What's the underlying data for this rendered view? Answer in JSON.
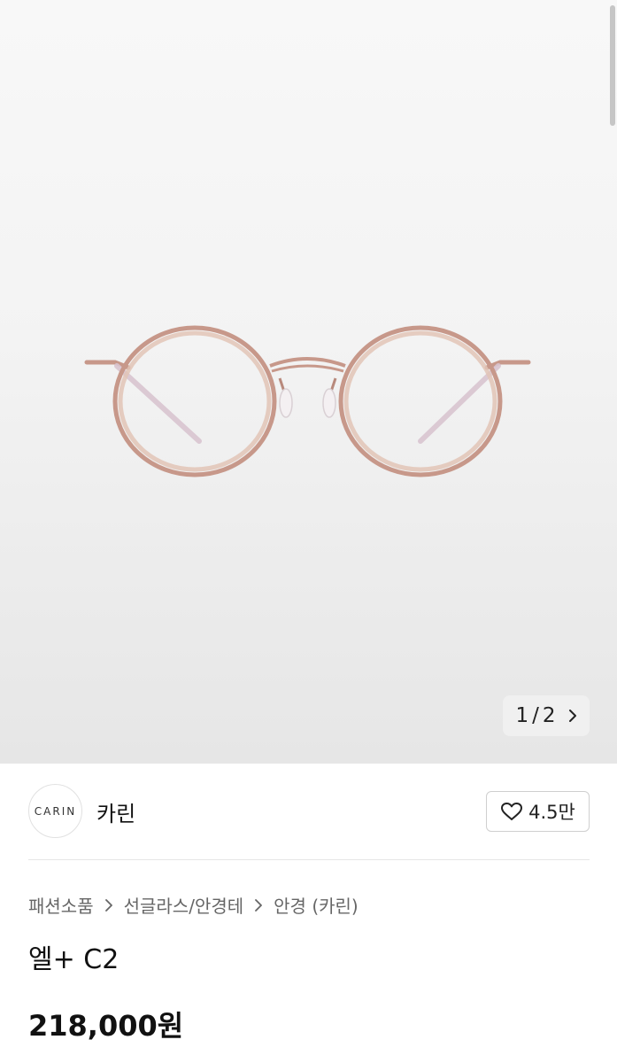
{
  "gallery": {
    "current_page": "1",
    "separator": "/",
    "total_pages": "2"
  },
  "brand": {
    "logo_text": "CARIN",
    "name": "카린",
    "likes": "4.5만"
  },
  "breadcrumb": {
    "items": [
      "패션소품",
      "선글라스/안경테",
      "안경 (카린)"
    ]
  },
  "product": {
    "title": "엘+ C2",
    "price": "218,000원"
  },
  "colors": {
    "frame": "#c7988a",
    "background": "#f3f3f3"
  }
}
